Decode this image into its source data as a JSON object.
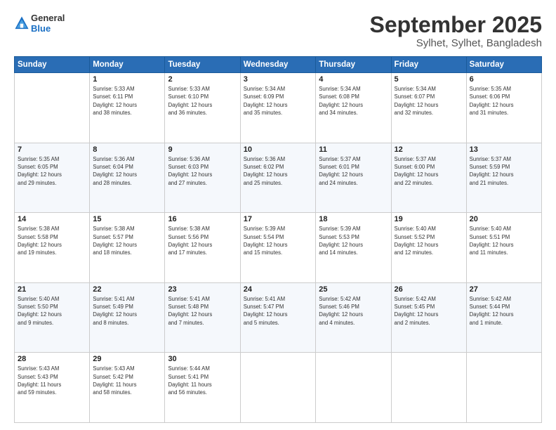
{
  "header": {
    "logo_general": "General",
    "logo_blue": "Blue",
    "month_title": "September 2025",
    "location": "Sylhet, Sylhet, Bangladesh"
  },
  "weekdays": [
    "Sunday",
    "Monday",
    "Tuesday",
    "Wednesday",
    "Thursday",
    "Friday",
    "Saturday"
  ],
  "weeks": [
    [
      {
        "day": "",
        "info": ""
      },
      {
        "day": "1",
        "info": "Sunrise: 5:33 AM\nSunset: 6:11 PM\nDaylight: 12 hours\nand 38 minutes."
      },
      {
        "day": "2",
        "info": "Sunrise: 5:33 AM\nSunset: 6:10 PM\nDaylight: 12 hours\nand 36 minutes."
      },
      {
        "day": "3",
        "info": "Sunrise: 5:34 AM\nSunset: 6:09 PM\nDaylight: 12 hours\nand 35 minutes."
      },
      {
        "day": "4",
        "info": "Sunrise: 5:34 AM\nSunset: 6:08 PM\nDaylight: 12 hours\nand 34 minutes."
      },
      {
        "day": "5",
        "info": "Sunrise: 5:34 AM\nSunset: 6:07 PM\nDaylight: 12 hours\nand 32 minutes."
      },
      {
        "day": "6",
        "info": "Sunrise: 5:35 AM\nSunset: 6:06 PM\nDaylight: 12 hours\nand 31 minutes."
      }
    ],
    [
      {
        "day": "7",
        "info": "Sunrise: 5:35 AM\nSunset: 6:05 PM\nDaylight: 12 hours\nand 29 minutes."
      },
      {
        "day": "8",
        "info": "Sunrise: 5:36 AM\nSunset: 6:04 PM\nDaylight: 12 hours\nand 28 minutes."
      },
      {
        "day": "9",
        "info": "Sunrise: 5:36 AM\nSunset: 6:03 PM\nDaylight: 12 hours\nand 27 minutes."
      },
      {
        "day": "10",
        "info": "Sunrise: 5:36 AM\nSunset: 6:02 PM\nDaylight: 12 hours\nand 25 minutes."
      },
      {
        "day": "11",
        "info": "Sunrise: 5:37 AM\nSunset: 6:01 PM\nDaylight: 12 hours\nand 24 minutes."
      },
      {
        "day": "12",
        "info": "Sunrise: 5:37 AM\nSunset: 6:00 PM\nDaylight: 12 hours\nand 22 minutes."
      },
      {
        "day": "13",
        "info": "Sunrise: 5:37 AM\nSunset: 5:59 PM\nDaylight: 12 hours\nand 21 minutes."
      }
    ],
    [
      {
        "day": "14",
        "info": "Sunrise: 5:38 AM\nSunset: 5:58 PM\nDaylight: 12 hours\nand 19 minutes."
      },
      {
        "day": "15",
        "info": "Sunrise: 5:38 AM\nSunset: 5:57 PM\nDaylight: 12 hours\nand 18 minutes."
      },
      {
        "day": "16",
        "info": "Sunrise: 5:38 AM\nSunset: 5:56 PM\nDaylight: 12 hours\nand 17 minutes."
      },
      {
        "day": "17",
        "info": "Sunrise: 5:39 AM\nSunset: 5:54 PM\nDaylight: 12 hours\nand 15 minutes."
      },
      {
        "day": "18",
        "info": "Sunrise: 5:39 AM\nSunset: 5:53 PM\nDaylight: 12 hours\nand 14 minutes."
      },
      {
        "day": "19",
        "info": "Sunrise: 5:40 AM\nSunset: 5:52 PM\nDaylight: 12 hours\nand 12 minutes."
      },
      {
        "day": "20",
        "info": "Sunrise: 5:40 AM\nSunset: 5:51 PM\nDaylight: 12 hours\nand 11 minutes."
      }
    ],
    [
      {
        "day": "21",
        "info": "Sunrise: 5:40 AM\nSunset: 5:50 PM\nDaylight: 12 hours\nand 9 minutes."
      },
      {
        "day": "22",
        "info": "Sunrise: 5:41 AM\nSunset: 5:49 PM\nDaylight: 12 hours\nand 8 minutes."
      },
      {
        "day": "23",
        "info": "Sunrise: 5:41 AM\nSunset: 5:48 PM\nDaylight: 12 hours\nand 7 minutes."
      },
      {
        "day": "24",
        "info": "Sunrise: 5:41 AM\nSunset: 5:47 PM\nDaylight: 12 hours\nand 5 minutes."
      },
      {
        "day": "25",
        "info": "Sunrise: 5:42 AM\nSunset: 5:46 PM\nDaylight: 12 hours\nand 4 minutes."
      },
      {
        "day": "26",
        "info": "Sunrise: 5:42 AM\nSunset: 5:45 PM\nDaylight: 12 hours\nand 2 minutes."
      },
      {
        "day": "27",
        "info": "Sunrise: 5:42 AM\nSunset: 5:44 PM\nDaylight: 12 hours\nand 1 minute."
      }
    ],
    [
      {
        "day": "28",
        "info": "Sunrise: 5:43 AM\nSunset: 5:43 PM\nDaylight: 11 hours\nand 59 minutes."
      },
      {
        "day": "29",
        "info": "Sunrise: 5:43 AM\nSunset: 5:42 PM\nDaylight: 11 hours\nand 58 minutes."
      },
      {
        "day": "30",
        "info": "Sunrise: 5:44 AM\nSunset: 5:41 PM\nDaylight: 11 hours\nand 56 minutes."
      },
      {
        "day": "",
        "info": ""
      },
      {
        "day": "",
        "info": ""
      },
      {
        "day": "",
        "info": ""
      },
      {
        "day": "",
        "info": ""
      }
    ]
  ]
}
